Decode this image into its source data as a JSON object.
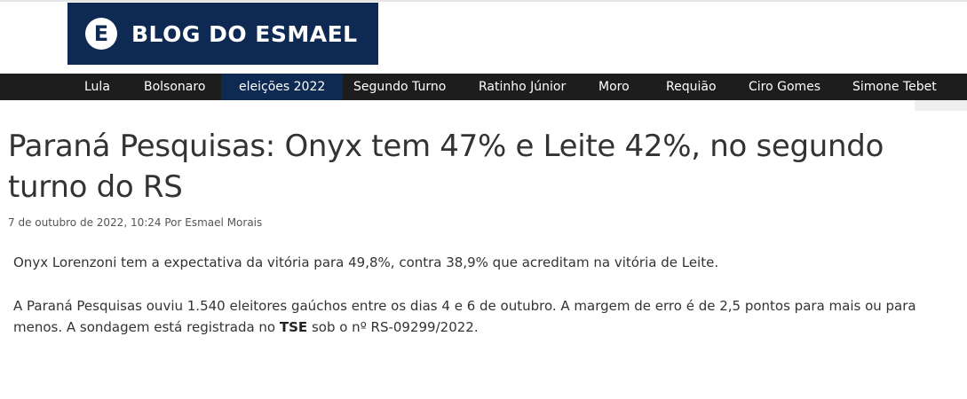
{
  "header": {
    "logo_mark": "E",
    "logo_text": "BLOG DO ESMAEL"
  },
  "nav": {
    "items": [
      {
        "label": "Lula"
      },
      {
        "label": "Bolsonaro"
      },
      {
        "label": "eleições 2022"
      },
      {
        "label": "Segundo Turno"
      },
      {
        "label": "Ratinho Júnior"
      },
      {
        "label": "Moro"
      },
      {
        "label": "Requião"
      },
      {
        "label": "Ciro Gomes"
      },
      {
        "label": "Simone Tebet"
      }
    ],
    "active": "eleições 2022"
  },
  "article": {
    "title": "Paraná Pesquisas: Onyx tem 47% e Leite 42%, no segundo turno do RS",
    "date": "7 de outubro de 2022, 10:24",
    "by": "Por",
    "author": "Esmael Morais",
    "paragraph1": "Onyx Lorenzoni tem a expectativa da vitória para 49,8%, contra 38,9% que acreditam na vitória de Leite.",
    "paragraph2_before": "A Paraná Pesquisas ouviu 1.540 eleitores gaúchos entre os dias 4 e 6 de outubro. A margem de erro é de 2,5 pontos para mais ou para menos. A sondagem está registrada no ",
    "paragraph2_bold": "TSE",
    "paragraph2_after": " sob o nº RS-09299/2022."
  },
  "colors": {
    "logo_bg": "#0f2a52",
    "nav_bg": "#1d1d1d",
    "nav_active": "#0f2a52"
  }
}
